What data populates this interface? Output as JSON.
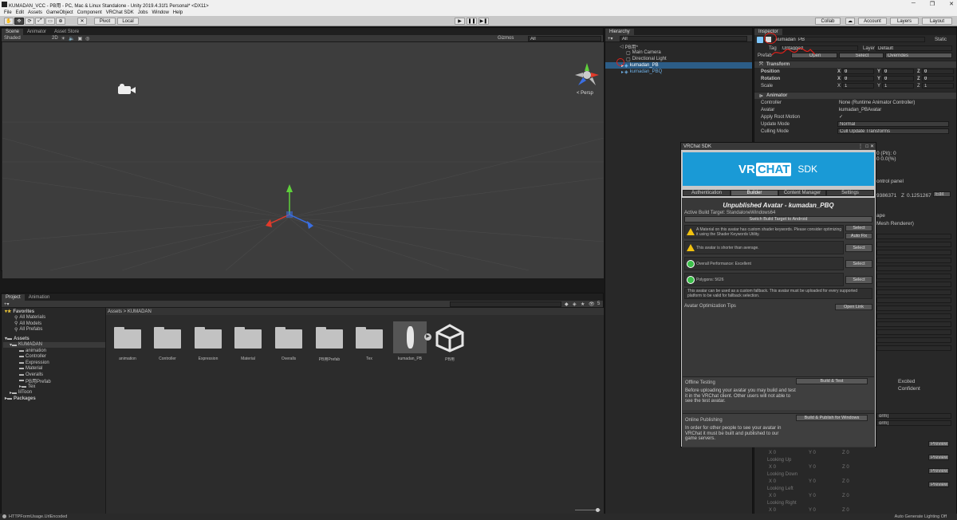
{
  "window": {
    "title": "KUMADAN_VCC - PB用 - PC, Mac & Linux Standalone - Unity 2019.4.31f1 Personal* <DX11>"
  },
  "menu": [
    "File",
    "Edit",
    "Assets",
    "GameObject",
    "Component",
    "VRChat SDK",
    "Jobs",
    "Window",
    "Help"
  ],
  "toolbar": {
    "pivot": "Pivot",
    "local": "Local",
    "collab": "Collab",
    "account": "Account",
    "layers": "Layers",
    "layout": "Layout"
  },
  "scene": {
    "tabs": [
      "Scene",
      "Animator",
      "Asset Store"
    ],
    "shading": "Shaded",
    "mode": "2D",
    "gizmos": "Gizmos",
    "search_placeholder": "All",
    "persp": "< Persp"
  },
  "hierarchy": {
    "tab": "Hierarchy",
    "search_placeholder": "All",
    "items": [
      {
        "label": "PB用*",
        "indent": 0,
        "selected": false
      },
      {
        "label": "Main Camera",
        "indent": 1,
        "selected": false
      },
      {
        "label": "Directional Light",
        "indent": 1,
        "selected": false
      },
      {
        "label": "kumadan_PB",
        "indent": 1,
        "selected": true
      },
      {
        "label": "kumadan_PBQ",
        "indent": 1,
        "selected": false
      }
    ]
  },
  "inspector": {
    "tab": "Inspector",
    "object_name": "kumadan_PB",
    "static": "Static",
    "tag_label": "Tag",
    "tag_value": "Untagged",
    "layer_label": "Layer",
    "layer_value": "Default",
    "prefab_label": "Prefab",
    "prefab_open": "Open",
    "prefab_select": "Select",
    "prefab_overrides": "Overrides",
    "transform": {
      "title": "Transform",
      "rows": [
        {
          "label": "Position",
          "x": "0",
          "y": "0",
          "z": "0"
        },
        {
          "label": "Rotation",
          "x": "0",
          "y": "0",
          "z": "0"
        },
        {
          "label": "Scale",
          "x": "1",
          "y": "1",
          "z": "1"
        }
      ]
    },
    "animator": {
      "title": "Animator",
      "rows": [
        {
          "label": "Controller",
          "value": "None (Runtime Animator Controller)"
        },
        {
          "label": "Avatar",
          "value": "kumadan_PBAvatar"
        },
        {
          "label": "Apply Root Motion",
          "value": "✓"
        },
        {
          "label": "Update Mode",
          "value": "Normal"
        },
        {
          "label": "Culling Mode",
          "value": "Cull Update Transforms"
        }
      ]
    },
    "partial": [
      "0 (Pit): 0",
      "0 0.0(%)",
      "ontrol panel",
      "9386371",
      "Z",
      "0.1251267",
      "Edit",
      "ape",
      "Mesh Renderer)",
      "Excited",
      "Confident",
      "Preview",
      "Preview",
      "Preview",
      "Preview",
      "orm)",
      "orm)"
    ],
    "eye_sections": [
      "Looking Up",
      "Looking Down",
      "Looking Left",
      "Looking Right"
    ]
  },
  "project": {
    "tabs": [
      "Project",
      "Animation"
    ],
    "search_placeholder": "",
    "breadcrumb": "Assets > KUMADAN",
    "tree": [
      {
        "label": "Favorites",
        "indent": 0,
        "bold": true
      },
      {
        "label": "All Materials",
        "indent": 1,
        "bold": false
      },
      {
        "label": "All Models",
        "indent": 1,
        "bold": false
      },
      {
        "label": "All Prefabs",
        "indent": 1,
        "bold": false
      },
      {
        "label": "Assets",
        "indent": 0,
        "bold": true
      },
      {
        "label": "KUMADAN",
        "indent": 1,
        "bold": false
      },
      {
        "label": "animation",
        "indent": 2,
        "bold": false
      },
      {
        "label": "Controller",
        "indent": 2,
        "bold": false
      },
      {
        "label": "Expression",
        "indent": 2,
        "bold": false
      },
      {
        "label": "Material",
        "indent": 2,
        "bold": false
      },
      {
        "label": "Overalls",
        "indent": 2,
        "bold": false
      },
      {
        "label": "PB用Prefab",
        "indent": 2,
        "bold": false
      },
      {
        "label": "Tex",
        "indent": 2,
        "bold": false
      },
      {
        "label": "lilToon",
        "indent": 1,
        "bold": false
      },
      {
        "label": "Packages",
        "indent": 0,
        "bold": true
      }
    ],
    "assets": [
      "animation",
      "Controller",
      "Expression",
      "Material",
      "Overalls",
      "PB用Prefab",
      "Tex",
      "kumadan_PB",
      "PB用"
    ],
    "count": "5"
  },
  "vrc": {
    "title": "VRChat SDK",
    "logo_left": "VR",
    "logo_mid": "CHAT",
    "logo_right": "SDK",
    "tabs": [
      "Authentication",
      "Builder",
      "Content Manager",
      "Settings"
    ],
    "heading": "Unpublished Avatar - kumadan_PBQ",
    "build_target": "Active Build Target: StandaloneWindows64",
    "switch_button": "Switch Build Target to Android",
    "messages": [
      {
        "icon": "warn",
        "text": "A Material on this avatar has custom shader keywords. Please consider optimizing it using the Shader Keywords Utility.",
        "buttons": [
          "Select",
          "Auto Fix"
        ]
      },
      {
        "icon": "warn",
        "text": "This avatar is shorter than average.",
        "buttons": [
          "Select"
        ]
      },
      {
        "icon": "good",
        "text": "Overall Performance: Excellent",
        "buttons": [
          "Select"
        ]
      },
      {
        "icon": "good",
        "text": "Polygons: 5626",
        "buttons": [
          "Select"
        ]
      }
    ],
    "fallback_note": "This avatar can be used as a custom fallback. This avatar must be uploaded for every supported platform to be valid for fallback selection.",
    "optimization_tips": "Avatar Optimization Tips",
    "open_link": "Open Link",
    "offline_title": "Offline Testing",
    "offline_button": "Build & Test",
    "offline_text": "Before uploading your avatar you may build and test it in the VRChat client. Other users will not able to see the test avatar.",
    "online_title": "Online Publishing",
    "online_button": "Build & Publish for Windows",
    "online_text": "In order for other people to see your avatar in VRChat it must be built and published to our game servers."
  },
  "status": {
    "left": "HTTPFormUsage.UrlEncoded",
    "right": "Auto Generate Lighting Off"
  },
  "colors": {
    "selection": "#2c5d87",
    "annotation": "#e0201a",
    "vrc_blue": "#1a9ad6"
  }
}
